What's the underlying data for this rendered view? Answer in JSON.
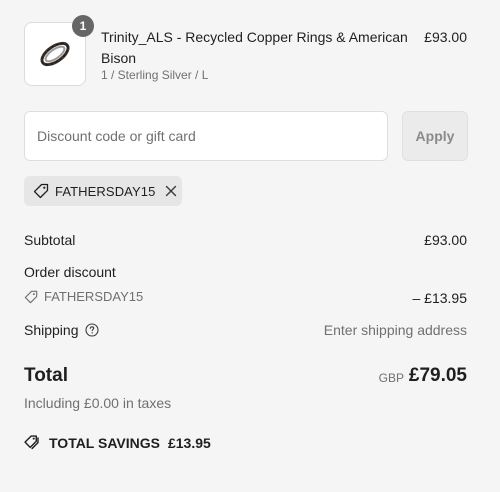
{
  "product": {
    "quantity": "1",
    "title": "Trinity_ALS - Recycled Copper Rings & American Bison",
    "variant": "1 / Sterling Silver / L",
    "price": "£93.00"
  },
  "discount_form": {
    "placeholder": "Discount code or gift card",
    "apply_label": "Apply"
  },
  "applied_code": {
    "code": "FATHERSDAY15"
  },
  "summary": {
    "subtotal_label": "Subtotal",
    "subtotal_value": "£93.00",
    "order_discount_label": "Order discount",
    "discount_code": "FATHERSDAY15",
    "discount_value": "– £13.95",
    "shipping_label": "Shipping",
    "shipping_value": "Enter shipping address",
    "total_label": "Total",
    "currency": "GBP",
    "total_value": "£79.05",
    "tax_note": "Including £0.00 in taxes",
    "savings_label": "TOTAL SAVINGS",
    "savings_value": "£13.95"
  },
  "colors": {
    "background": "#f5f5f5",
    "text": "#1f1f1f",
    "muted": "#707070",
    "badge": "#666666"
  }
}
